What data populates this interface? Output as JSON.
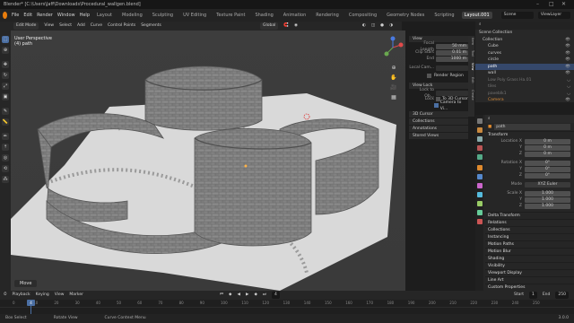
{
  "window": {
    "title": "Blender* [C:\\Users\\Jaff\\Downloads\\Procedural_wallgen.blend]"
  },
  "menu": {
    "items": [
      "File",
      "Edit",
      "Render",
      "Window",
      "Help"
    ]
  },
  "workspaces": [
    "Layout",
    "Modeling",
    "Sculpting",
    "UV Editing",
    "Texture Paint",
    "Shading",
    "Animation",
    "Rendering",
    "Compositing",
    "Geometry Nodes",
    "Scripting",
    "Layout.001"
  ],
  "active_workspace": "Layout.001",
  "scene": "Scene",
  "view_layer": "ViewLayer",
  "viewport_header": {
    "mode": "Edit Mode",
    "menus": [
      "View",
      "Select",
      "Add",
      "Curve",
      "Control Points",
      "Segments"
    ],
    "orientation": "Global"
  },
  "overlay": {
    "line1": "User Perspective",
    "line2": "(4) path"
  },
  "npanel": {
    "view_header": "View",
    "focal_label": "Focal Length",
    "focal_value": "50 mm",
    "clip_start_label": "Clip Start",
    "clip_start_value": "0.01 m",
    "clip_end_label": "End",
    "clip_end_value": "1000 m",
    "local_camera_label": "Local Cam...",
    "render_region_label": "Render Region",
    "view_lock_header": "View Lock",
    "lock_to_object_label": "Lock to Ob...",
    "lock_label": "Lock",
    "to_3d_cursor": "To 3D Cursor",
    "camera_to_view": "Camera to Vi...",
    "cursor_header": "3D Cursor",
    "collections_header": "Collections",
    "annotations_header": "Annotations",
    "stored_views_header": "Stored Views",
    "tabs": [
      "Item",
      "Tool",
      "View",
      "Edit",
      "Create"
    ]
  },
  "outliner": {
    "rows": [
      {
        "label": "Scene Collection",
        "selected": false,
        "icon": "collection-icon"
      },
      {
        "label": "Collection",
        "selected": false,
        "icon": "collection-icon"
      },
      {
        "label": "Cube",
        "selected": false,
        "icon": "mesh-icon"
      },
      {
        "label": "curves",
        "selected": false,
        "icon": "curve-icon"
      },
      {
        "label": "circle",
        "selected": false,
        "icon": "curve-icon"
      },
      {
        "label": "path",
        "selected": true,
        "icon": "curve-icon"
      },
      {
        "label": "wall",
        "selected": false,
        "icon": "mesh-icon"
      },
      {
        "label": "Low Poly Grass Ha.01",
        "selected": false,
        "icon": "mesh-icon"
      },
      {
        "label": "tiles",
        "selected": false,
        "icon": "mesh-icon"
      },
      {
        "label": "paveblk1",
        "selected": false,
        "icon": "mesh-icon"
      },
      {
        "label": "Camera",
        "selected": false,
        "icon": "camera-icon"
      }
    ]
  },
  "properties": {
    "object_name": "path",
    "transform_header": "Transform",
    "location": {
      "label": "Location X",
      "x": "0 m",
      "y": "0 m",
      "z": "0 m"
    },
    "rotation": {
      "label": "Rotation X",
      "x": "0°",
      "y": "0°",
      "z": "0°"
    },
    "mode_label": "Mode",
    "mode_value": "XYZ Euler",
    "scale": {
      "label": "Scale X",
      "x": "1.000",
      "y": "1.000",
      "z": "1.000"
    },
    "axis_y": "Y",
    "axis_z": "Z",
    "sections": [
      "Delta Transform",
      "Relations",
      "Collections",
      "Instancing",
      "Motion Paths",
      "Motion Blur",
      "Shading",
      "Visibility",
      "Viewport Display",
      "Line Art",
      "Custom Properties"
    ]
  },
  "timeline": {
    "menus": [
      "Playback",
      "Keying",
      "View",
      "Marker"
    ],
    "frame_current": "4",
    "start_label": "Start",
    "start": "1",
    "end_label": "End",
    "end": "250",
    "ticks": [
      "0",
      "10",
      "20",
      "30",
      "40",
      "50",
      "60",
      "70",
      "80",
      "90",
      "100",
      "110",
      "120",
      "130",
      "140",
      "150",
      "160",
      "170",
      "180",
      "190",
      "200",
      "210",
      "220",
      "230",
      "240",
      "250"
    ]
  },
  "statusbar": {
    "items": [
      "Box Select",
      "Rotate View",
      "Curve Context Menu"
    ],
    "version": "3.0.0"
  },
  "move_label": "Move",
  "colors": {
    "accent": "#e87d0d",
    "selected": "#35486b",
    "active_tool": "#4b6fa3"
  }
}
